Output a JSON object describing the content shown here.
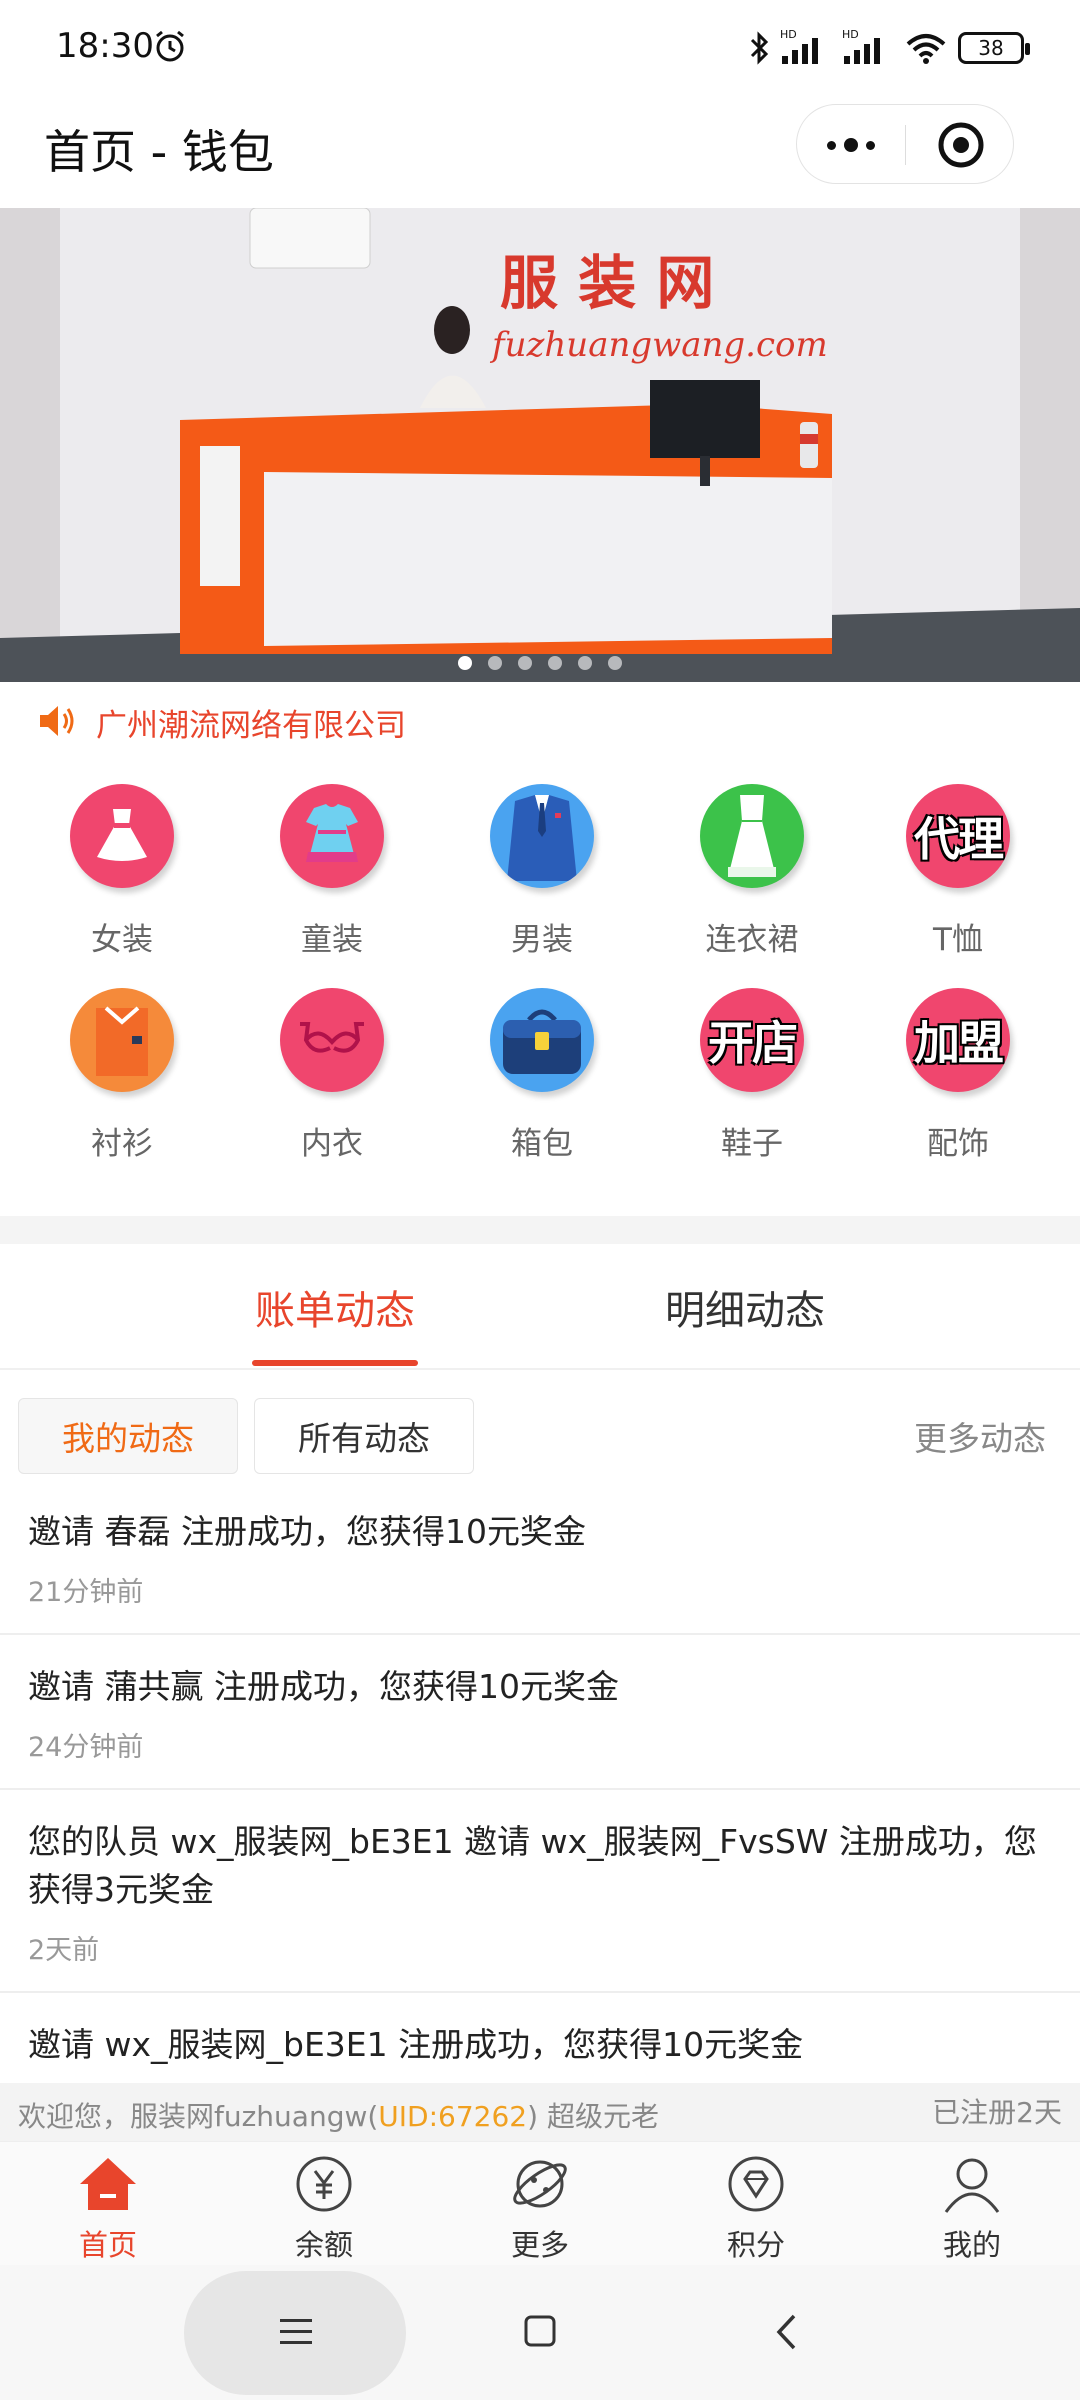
{
  "status_bar": {
    "time": "18:30",
    "battery": "38",
    "network_labels": [
      "HD",
      "HD"
    ]
  },
  "title_bar": {
    "title": "首页 - 钱包"
  },
  "banner": {
    "sign_text": "服 装 网",
    "sign_url": "fuzhuangwang.com",
    "slide_count": 6,
    "active_slide": 1
  },
  "notice": {
    "text": "广州潮流网络有限公司"
  },
  "categories": [
    {
      "label": "女装",
      "icon": "dress-icon",
      "color": "#f0466e"
    },
    {
      "label": "童装",
      "icon": "kids-dress-icon",
      "color": "#f0466e"
    },
    {
      "label": "男装",
      "icon": "suit-icon",
      "color": "#4aa3f0"
    },
    {
      "label": "连衣裙",
      "icon": "gown-icon",
      "color": "#3cc24a"
    },
    {
      "label": "T恤",
      "icon": "text-badge",
      "badge": "代理",
      "color": "#f0466e"
    },
    {
      "label": "衬衫",
      "icon": "shirt-icon",
      "color": "#f58a3a"
    },
    {
      "label": "内衣",
      "icon": "bra-icon",
      "color": "#f0466e"
    },
    {
      "label": "箱包",
      "icon": "bag-icon",
      "color": "#4aa3f0"
    },
    {
      "label": "鞋子",
      "icon": "text-badge",
      "badge": "开店",
      "color": "#f0466e"
    },
    {
      "label": "配饰",
      "icon": "text-badge",
      "badge": "加盟",
      "color": "#f0466e"
    }
  ],
  "tabs": [
    {
      "label": "账单动态",
      "active": true
    },
    {
      "label": "明细动态",
      "active": false
    }
  ],
  "filters": {
    "mine": "我的动态",
    "all": "所有动态",
    "more": "更多动态"
  },
  "feed": [
    {
      "msg": "邀请 春磊 注册成功，您获得10元奖金",
      "time": "21分钟前"
    },
    {
      "msg": "邀请 蒲共赢 注册成功，您获得10元奖金",
      "time": "24分钟前"
    },
    {
      "msg": "您的队员 wx_服装网_bE3E1 邀请 wx_服装网_FvsSW 注册成功，您获得3元奖金",
      "time": "2天前"
    },
    {
      "msg": "邀请 wx_服装网_bE3E1 注册成功，您获得10元奖金",
      "time": ""
    }
  ],
  "welcome": {
    "prefix": "欢迎您，服装网fuzhuangw(",
    "uid": "UID:67262",
    "suffix": ") 超级元老",
    "registered": "已注册2天"
  },
  "bottom_nav": [
    {
      "label": "首页",
      "icon": "home-icon",
      "active": true
    },
    {
      "label": "余额",
      "icon": "yuan-icon",
      "active": false
    },
    {
      "label": "更多",
      "icon": "planet-icon",
      "active": false
    },
    {
      "label": "积分",
      "icon": "diamond-icon",
      "active": false
    },
    {
      "label": "我的",
      "icon": "user-icon",
      "active": false
    }
  ],
  "colors": {
    "accent": "#e8452c",
    "orange": "#f06a15",
    "uid": "#f0a020"
  }
}
